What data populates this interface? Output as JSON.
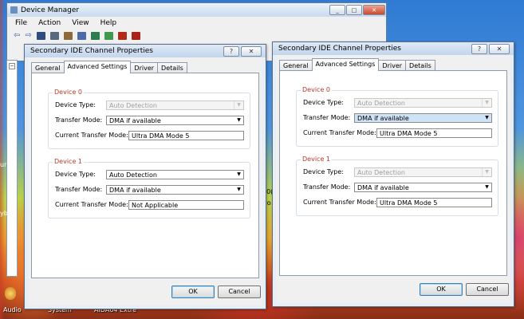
{
  "device_manager": {
    "title": "Device Manager",
    "menu": [
      "File",
      "Action",
      "View",
      "Help"
    ],
    "window_buttons": [
      "_",
      "□",
      "✕"
    ]
  },
  "background_fragments": {
    "frag1": "70(",
    "frag2": "yo",
    "frag3": "ur",
    "frag4": "yb"
  },
  "desktop_icons": [
    "Audio",
    "System",
    "AIDA64 Extre"
  ],
  "dialog_left": {
    "title": "Secondary IDE Channel Properties",
    "help_btn": "?",
    "close_btn": "✕",
    "tabs": [
      "General",
      "Advanced Settings",
      "Driver",
      "Details"
    ],
    "active_tab": "Advanced Settings",
    "device0": {
      "label": "Device 0",
      "device_type_label": "Device Type:",
      "device_type_value": "Auto Detection",
      "transfer_mode_label": "Transfer Mode:",
      "transfer_mode_value": "DMA if available",
      "current_mode_label": "Current Transfer Mode:",
      "current_mode_value": "Ultra DMA Mode 5"
    },
    "device1": {
      "label": "Device 1",
      "device_type_label": "Device Type:",
      "device_type_value": "Auto Detection",
      "transfer_mode_label": "Transfer Mode:",
      "transfer_mode_value": "DMA if available",
      "current_mode_label": "Current Transfer Mode:",
      "current_mode_value": "Not Applicable"
    },
    "ok": "OK",
    "cancel": "Cancel"
  },
  "dialog_right": {
    "title": "Secondary IDE Channel Properties",
    "help_btn": "?",
    "close_btn": "✕",
    "tabs": [
      "General",
      "Advanced Settings",
      "Driver",
      "Details"
    ],
    "active_tab": "Advanced Settings",
    "device0": {
      "label": "Device 0",
      "device_type_label": "Device Type:",
      "device_type_value": "Auto Detection",
      "transfer_mode_label": "Transfer Mode:",
      "transfer_mode_value": "DMA if available",
      "current_mode_label": "Current Transfer Mode:",
      "current_mode_value": "Ultra DMA Mode 5"
    },
    "device1": {
      "label": "Device 1",
      "device_type_label": "Device Type:",
      "device_type_value": "Auto Detection",
      "transfer_mode_label": "Transfer Mode:",
      "transfer_mode_value": "DMA if available",
      "current_mode_label": "Current Transfer Mode:",
      "current_mode_value": "Ultra DMA Mode 5"
    },
    "ok": "OK",
    "cancel": "Cancel"
  },
  "colors": {
    "group_label": "#b23a2a",
    "focus_highlight": "#cfe3f7"
  }
}
